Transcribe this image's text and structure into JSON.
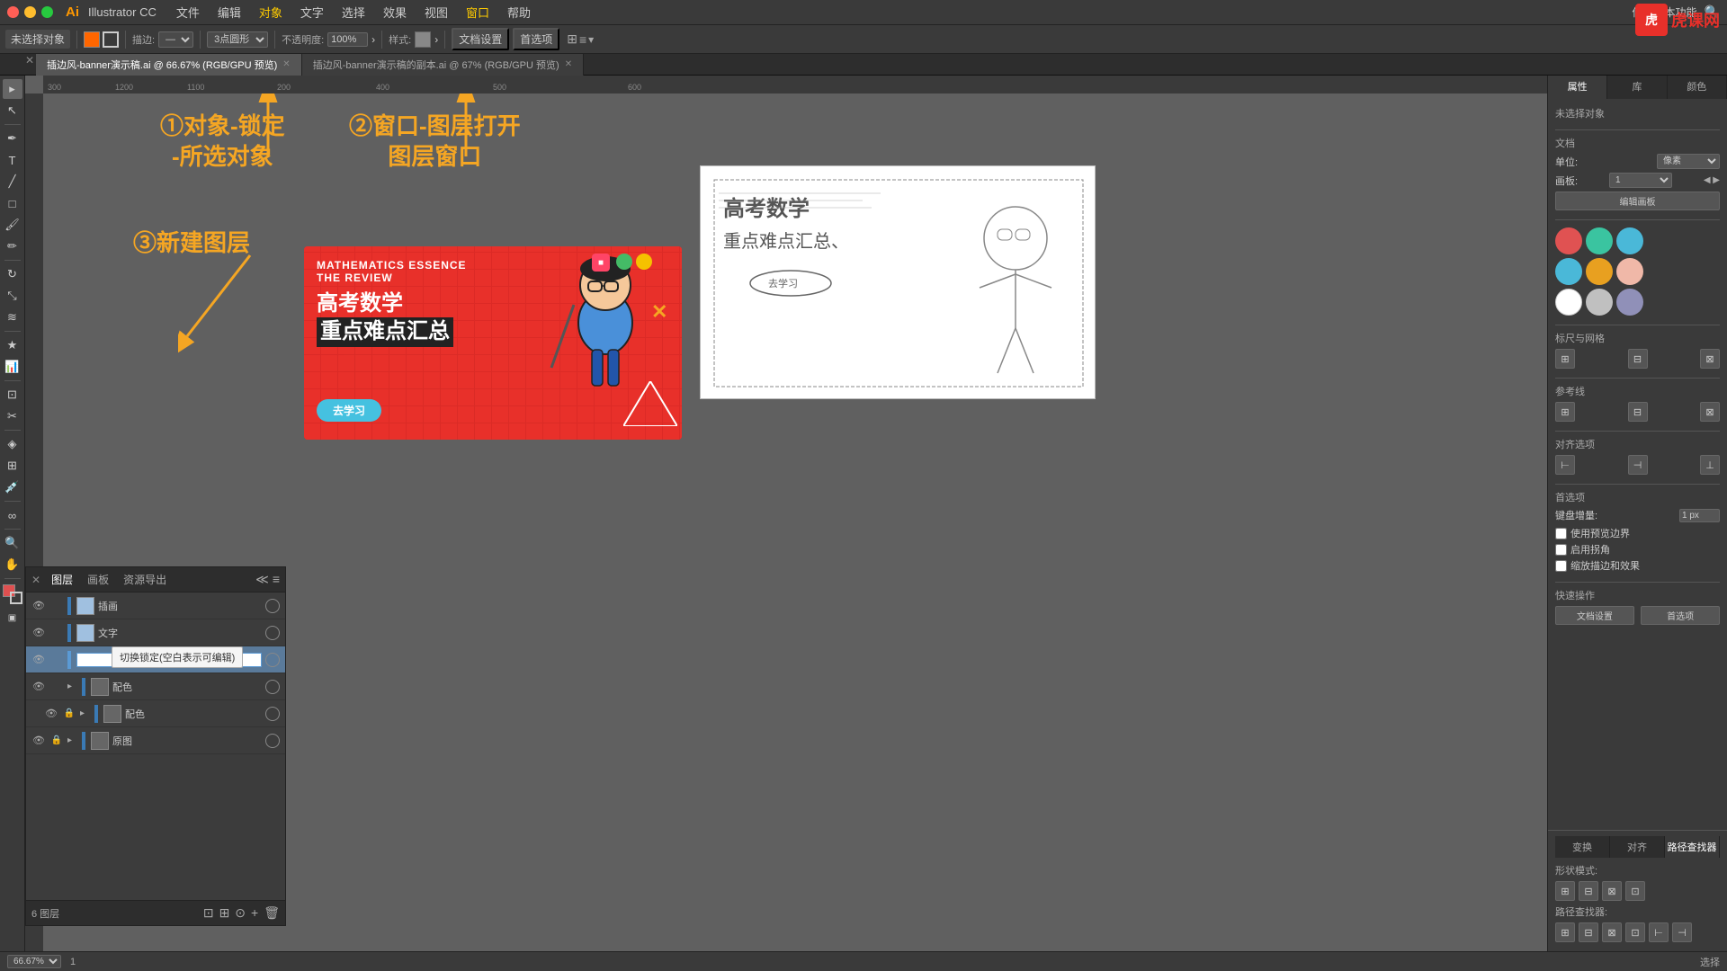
{
  "app": {
    "name": "Illustrator CC",
    "logo": "Ai",
    "traffic": [
      "red",
      "yellow",
      "green"
    ]
  },
  "menu": {
    "items": [
      "文件",
      "编辑",
      "对象",
      "文字",
      "选择",
      "效果",
      "视图",
      "窗口",
      "帮助"
    ],
    "right": "传统基本功能"
  },
  "toolbar": {
    "noselect": "未选择对象",
    "stroke_label": "描边:",
    "shape_label": "3点圆形",
    "opacity_label": "不透明度:",
    "opacity_value": "100%",
    "style_label": "样式:",
    "doc_settings": "文档设置",
    "preferences": "首选项"
  },
  "tabs": [
    {
      "name": "插边风-banner演示稿.ai @ 66.67% (RGB/GPU 预览)",
      "active": true
    },
    {
      "name": "插边风-banner演示稿的副本.ai @ 67% (RGB/GPU 预览)",
      "active": false
    }
  ],
  "annotations": {
    "first": "①对象-锁定\n-所选对象",
    "second": "②窗口-图层打开\n图层窗口",
    "third": "③新建图层"
  },
  "layers_panel": {
    "title": "图层",
    "tabs": [
      "图层",
      "画板",
      "资源导出"
    ],
    "layers": [
      {
        "name": "插画",
        "locked": false,
        "visible": true,
        "active": false,
        "color": "#3a7ab5"
      },
      {
        "name": "文字",
        "locked": false,
        "visible": true,
        "active": false,
        "color": "#3a7ab5"
      },
      {
        "name": "",
        "locked": false,
        "visible": true,
        "active": true,
        "color": "#5a9ad5",
        "editing": true
      },
      {
        "name": "配色",
        "locked": false,
        "visible": true,
        "active": false,
        "color": "#3a7ab5",
        "hasChildren": true
      },
      {
        "name": "配色",
        "locked": true,
        "visible": true,
        "active": false,
        "color": "#3a7ab5",
        "hasChildren": true,
        "indent": true
      },
      {
        "name": "原图",
        "locked": true,
        "visible": true,
        "active": false,
        "color": "#3a7ab5",
        "hasChildren": true
      }
    ],
    "count": "6 图层",
    "tooltip": "切换锁定(空白表示可编辑)"
  },
  "banner": {
    "title1": "MATHEMATICS ESSENCE",
    "title2": "THE REVIEW",
    "heading1": "高考数学",
    "heading2": "重点难点汇总",
    "button": "去学习",
    "highlight_text": "重点难点汇总"
  },
  "right_panel": {
    "tabs": [
      "属性",
      "库",
      "颜色"
    ],
    "active_tab": "属性",
    "no_selection": "未选择对象",
    "doc_label": "文档",
    "unit_label": "单位:",
    "unit_value": "像素",
    "artboard_label": "画板:",
    "artboard_value": "1",
    "edit_artboard_btn": "编辑画板",
    "align_label": "标尺与网格",
    "align_section": "参考线",
    "align_options": "对齐选项",
    "snap_section": "首选项",
    "snap_label": "键盘增量:",
    "snap_value": "1 px",
    "use_preview": "使用预览边界",
    "round_corners": "启用拐角",
    "snap_effect": "缩放描边和效果",
    "quick_actions": "快速操作",
    "doc_settings_btn": "文档设置",
    "preferences_btn": "首选项",
    "colors": [
      "#e05252",
      "#3ac4a0",
      "#4ab8d8",
      "#4ab8d8",
      "#e8a020",
      "#f0b8a8",
      "#ffffff",
      "#c0c0c0",
      "#9090b8"
    ],
    "bottom_tabs": [
      "变换",
      "对齐",
      "路径查找器"
    ],
    "active_bottom": "路径查找器",
    "shape_modes": "形状模式:",
    "path_finder": "路径查找器:"
  },
  "status_bar": {
    "zoom": "66.67%",
    "page": "1",
    "tool": "选择"
  },
  "tihu": {
    "box_text": "虎",
    "text": "虎课网"
  }
}
